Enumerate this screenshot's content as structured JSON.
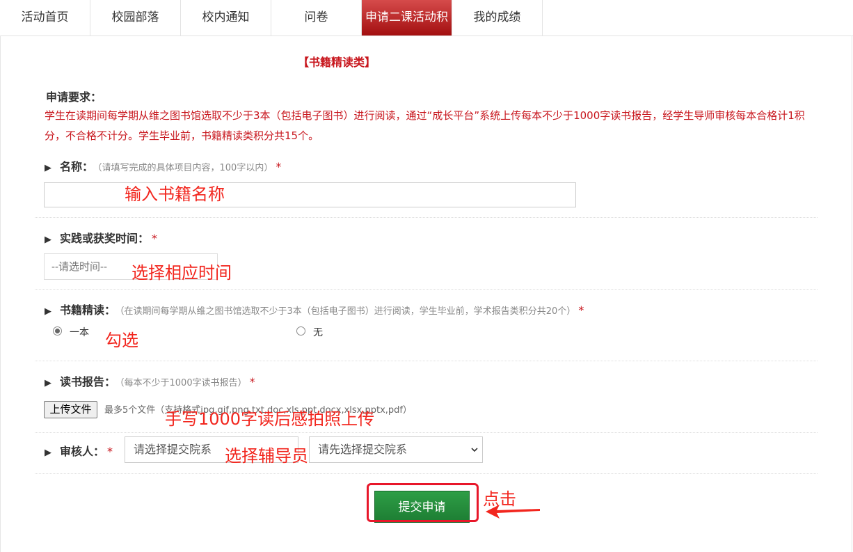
{
  "nav": {
    "tabs": [
      {
        "label": "活动首页"
      },
      {
        "label": "校园部落"
      },
      {
        "label": "校内通知"
      },
      {
        "label": "问卷"
      },
      {
        "label": "申请二课活动积"
      },
      {
        "label": "我的成绩"
      }
    ],
    "active_index": 4
  },
  "form": {
    "category_title": "【书籍精读类】",
    "requirements_label": "申请要求：",
    "requirements_text": "学生在读期间每学期从维之图书馆选取不少于3本（包括电子图书）进行阅读，通过“成长平台”系统上传每本不少于1000字读书报告，经学生导师审核每本合格计1积分，不合格不计分。学生毕业前，书籍精读类积分共15个。",
    "name": {
      "label": "名称：",
      "hint": "（请填写完成的具体项目内容，100字以内）",
      "required": "*",
      "value": ""
    },
    "time": {
      "label": "实践或获奖时间：",
      "required": "*",
      "placeholder": "--请选时间--"
    },
    "reading": {
      "label": "书籍精读：",
      "hint": "（在读期间每学期从维之图书馆选取不少于3本（包括电子图书）进行阅读，学生毕业前，学术报告类积分共20个）",
      "required": "*",
      "options": [
        {
          "label": "一本",
          "checked": true
        },
        {
          "label": "无",
          "checked": false
        }
      ]
    },
    "report": {
      "label": "读书报告：",
      "hint": "（每本不少于1000字读书报告）",
      "required": "*",
      "upload_label": "上传文件",
      "upload_hint": "最多5个文件（支持格式jpg,gif,png,txt,doc,xls,ppt,docx,xlsx,pptx,pdf）"
    },
    "reviewer": {
      "label": "审核人：",
      "required": "*",
      "dept_select": "请选择提交院系",
      "reviewer_select": "请先选择提交院系"
    },
    "submit_label": "提交申请"
  },
  "annotations": {
    "name": "输入书籍名称",
    "time": "选择相应时间",
    "check": "勾选",
    "upload": "手写1000字读后感拍照上传",
    "reviewer": "选择辅导员",
    "click": "点击"
  }
}
